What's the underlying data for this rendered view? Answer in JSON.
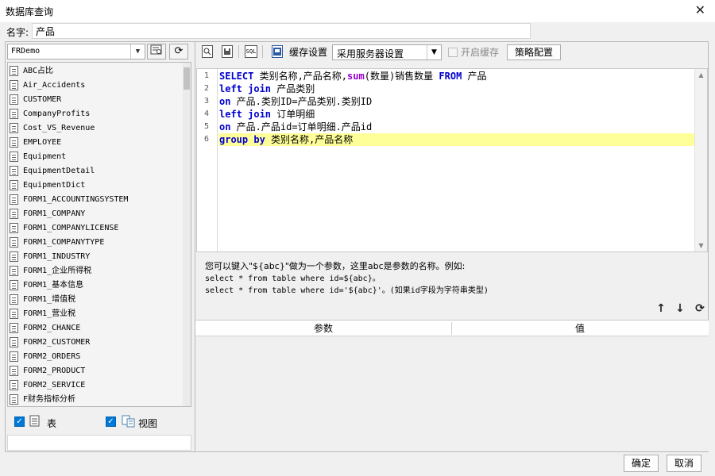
{
  "window": {
    "title": "数据库查询",
    "close_glyph": "✕"
  },
  "name_row": {
    "label": "名字:",
    "value": "产品"
  },
  "left": {
    "datasource": "FRDemo",
    "tables": [
      "ABC占比",
      "Air_Accidents",
      "CUSTOMER",
      "CompanyProfits",
      "Cost_VS_Revenue",
      "EMPLOYEE",
      "Equipment",
      "EquipmentDetail",
      "EquipmentDict",
      "FORM1_ACCOUNTINGSYSTEM",
      "FORM1_COMPANY",
      "FORM1_COMPANYLICENSE",
      "FORM1_COMPANYTYPE",
      "FORM1_INDUSTRY",
      "FORM1_企业所得税",
      "FORM1_基本信息",
      "FORM1_增值税",
      "FORM1_营业税",
      "FORM2_CHANCE",
      "FORM2_CUSTOMER",
      "FORM2_ORDERS",
      "FORM2_PRODUCT",
      "FORM2_SERVICE",
      "F财务指标分析"
    ],
    "show_tables_label": "表",
    "show_views_label": "视图"
  },
  "right": {
    "cache_settings_label": "缓存设置",
    "server_setting_value": "采用服务器设置",
    "enable_cache_label": "开启缓存",
    "strategy_button": "策略配置",
    "sql_icon_text": "SQL",
    "line_numbers": [
      "1",
      "2",
      "3",
      "4",
      "5",
      "6"
    ],
    "sql_lines": [
      [
        {
          "t": "SELECT",
          "c": "kw"
        },
        {
          "t": " 类别名称,产品名称,",
          "c": ""
        },
        {
          "t": "sum",
          "c": "fn"
        },
        {
          "t": "(数量)销售数量 ",
          "c": ""
        },
        {
          "t": "FROM",
          "c": "kw"
        },
        {
          "t": " 产品",
          "c": ""
        }
      ],
      [
        {
          "t": "left join",
          "c": "kw"
        },
        {
          "t": " 产品类别",
          "c": ""
        }
      ],
      [
        {
          "t": "on",
          "c": "kw"
        },
        {
          "t": " 产品.类别ID=产品类别.类别ID",
          "c": ""
        }
      ],
      [
        {
          "t": "left join",
          "c": "kw"
        },
        {
          "t": " 订单明细",
          "c": ""
        }
      ],
      [
        {
          "t": "on",
          "c": "kw"
        },
        {
          "t": " 产品.产品id=订单明细.产品id",
          "c": ""
        }
      ],
      [
        {
          "t": "group by",
          "c": "kw"
        },
        {
          "t": " 类别名称,产品名称",
          "c": ""
        }
      ]
    ],
    "hint_lines": [
      "您可以键入\"${abc}\"做为一个参数，这里abc是参数的名称。例如:",
      "select * from table where id=${abc}。",
      "select * from table where id='${abc}'。(如果id字段为字符串类型)"
    ],
    "param_table": {
      "col_param": "参数",
      "col_value": "值"
    }
  },
  "footer": {
    "ok": "确定",
    "cancel": "取消"
  }
}
